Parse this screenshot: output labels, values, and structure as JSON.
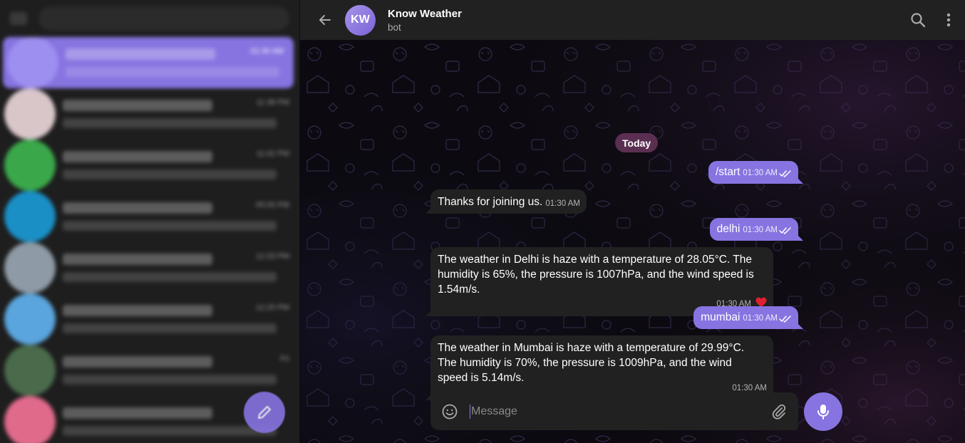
{
  "sidebar": {
    "chats": [
      {
        "time": "01:30 AM",
        "avatar_color": "#9d8ff0",
        "active": true
      },
      {
        "time": "11:38 PM",
        "avatar_color": "#d8c6c9",
        "active": false
      },
      {
        "time": "11:02 PM",
        "avatar_color": "#3aa84a",
        "active": false
      },
      {
        "time": "05:00 PM",
        "avatar_color": "#1a8fc6",
        "active": false
      },
      {
        "time": "12:33 PM",
        "avatar_color": "#8e9aa5",
        "active": false
      },
      {
        "time": "12:25 PM",
        "avatar_color": "#5aa5dd",
        "active": false
      },
      {
        "time": "Fri",
        "avatar_color": "#4a6b4b",
        "active": false
      },
      {
        "time": "",
        "avatar_color": "#e06a8a",
        "active": false
      }
    ]
  },
  "header": {
    "avatar_initials": "KW",
    "title": "Know Weather",
    "subtitle": "bot"
  },
  "chat": {
    "date_separator": "Today",
    "messages": [
      {
        "direction": "out",
        "text": "/start",
        "time": "01:30 AM"
      },
      {
        "direction": "in",
        "text": "Thanks for joining us.",
        "time": "01:30 AM"
      },
      {
        "direction": "out",
        "text": "delhi",
        "time": "01:30 AM"
      },
      {
        "direction": "in",
        "text": "The weather in Delhi is haze with a temperature of 28.05°C. The humidity is 65%, the pressure is 1007hPa, and the wind speed is 1.54m/s.",
        "time": "01:30 AM",
        "reaction": "❤️"
      },
      {
        "direction": "out",
        "text": "mumbai",
        "time": "01:30 AM"
      },
      {
        "direction": "in",
        "text": "The weather in Mumbai is haze with a temperature of 29.99°C. The humidity is 70%, the pressure is 1009hPa, and the wind speed is 5.14m/s.",
        "time": "01:30 AM"
      }
    ]
  },
  "composer": {
    "placeholder": "Message"
  },
  "colors": {
    "accent": "#8774e1",
    "bubble_in": "#212121",
    "date_pill": "#5b2f52",
    "reaction": "#e0202e"
  },
  "icons": [
    "back-arrow-icon",
    "search-icon",
    "more-icon",
    "emoji-icon",
    "attach-icon",
    "mic-icon",
    "pencil-icon",
    "double-check-icon",
    "heart-icon"
  ]
}
